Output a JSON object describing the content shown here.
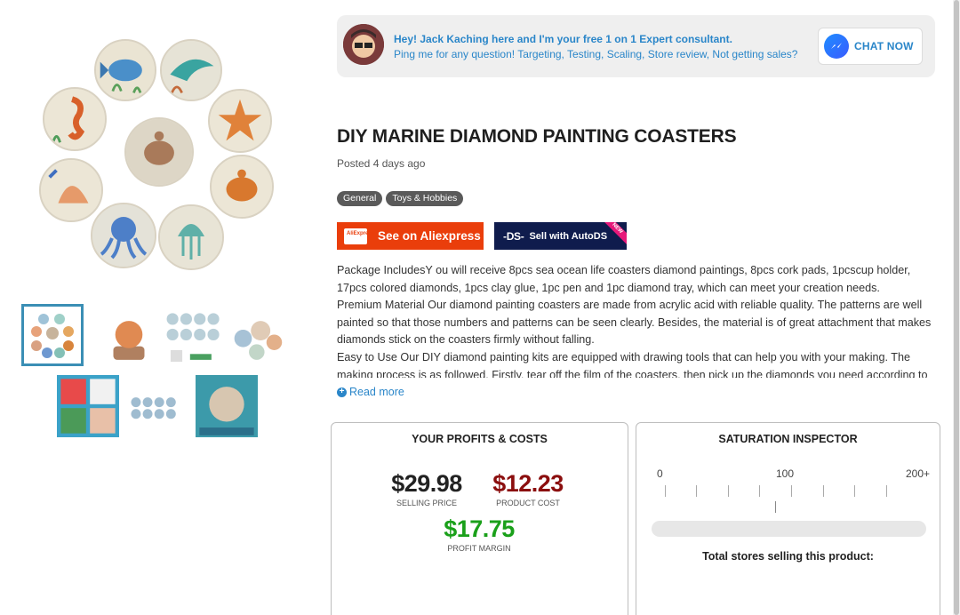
{
  "expert": {
    "line1": "Hey! Jack Kaching here and I'm your free 1 on 1 Expert consultant.",
    "line2": "Ping me for any question! Targeting, Testing, Scaling, Store review, Not getting sales?",
    "chat_label": "CHAT NOW"
  },
  "product": {
    "title": "DIY MARINE DIAMOND PAINTING COASTERS",
    "posted": "Posted 4 days ago",
    "tags": [
      "General",
      "Toys & Hobbies"
    ],
    "aliexpress_label": "See on Aliexpress",
    "aliexpress_logo_text": "AliExpress",
    "autods_mark": "-DS-",
    "autods_label": "Sell with AutoDS",
    "autods_badge": "NEW",
    "description": [
      "Package IncludesY ou will receive 8pcs sea ocean life coasters diamond paintings, 8pcs cork pads, 1pcscup holder, 17pcs colored diamonds, 1pcs clay glue, 1pc pen and 1pc diamond tray, which can meet your creation needs.",
      "Premium Material Our diamond painting coasters are made from acrylic acid with reliable quality. The patterns are well painted so that those numbers and patterns can be seen clearly. Besides, the material is of great attachment that makes diamonds stick on the coasters firmly without falling.",
      "Easy to Use Our DIY diamond painting kits are equipped with drawing tools that can help you with your making. The making process is as followed. Firstly, tear off the film of the coasters, then pick up the diamonds you need according to"
    ],
    "read_more": "Read more"
  },
  "profits": {
    "title": "YOUR PROFITS & COSTS",
    "selling_price": "$29.98",
    "selling_price_label": "SELLING PRICE",
    "product_cost": "$12.23",
    "product_cost_label": "PRODUCT COST",
    "profit_margin": "$17.75",
    "profit_margin_label": "PROFIT MARGIN"
  },
  "saturation": {
    "title": "SATURATION INSPECTOR",
    "scale": [
      "0",
      "100",
      "200+"
    ],
    "fill_fraction": 0,
    "total_label": "Total stores selling this product:"
  },
  "colors": {
    "accent_blue": "#2a86c9",
    "aliexpress_red": "#ea3e0b",
    "autods_navy": "#0f1c4d",
    "cost_red": "#8b0e0e",
    "profit_green": "#1aa01a"
  }
}
